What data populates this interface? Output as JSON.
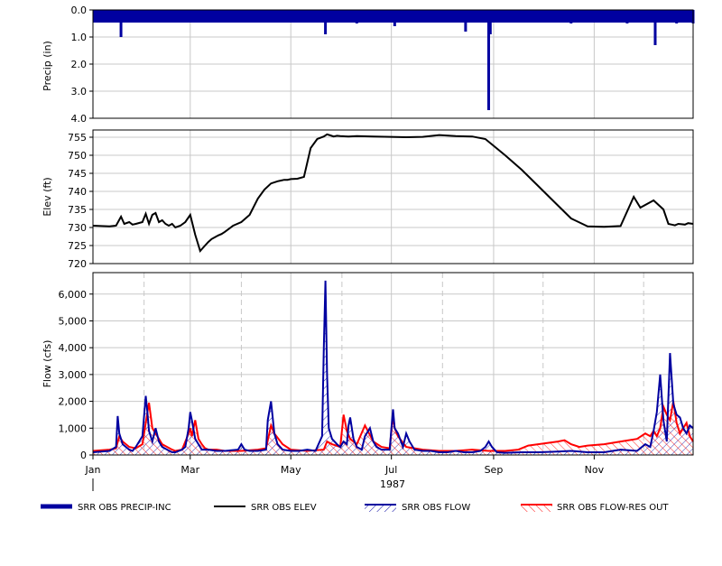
{
  "chart_data": [
    {
      "type": "bar",
      "panel": "precip",
      "ylabel": "Precip (in)",
      "ylim": [
        4.0,
        0.0
      ],
      "yticks": [
        "0.0",
        "1.0",
        "2.0",
        "3.0",
        "4.0"
      ],
      "ytick_values": [
        0,
        1,
        2,
        3,
        4
      ],
      "grid": true,
      "series": [
        {
          "name": "SRR OBS PRECIP-INC",
          "color": "#0000a0",
          "day": [
            3,
            6,
            10,
            14,
            17,
            20,
            24,
            29,
            33,
            38,
            44,
            51,
            56,
            59,
            63,
            70,
            76,
            80,
            85,
            90,
            96,
            102,
            105,
            110,
            114,
            120,
            126,
            130,
            136,
            141,
            146,
            150,
            153,
            160,
            162,
            167,
            172,
            175,
            179,
            183,
            186,
            189,
            196,
            201,
            206,
            210,
            214,
            218,
            226,
            233,
            239,
            240,
            241,
            246,
            253,
            259,
            266,
            270,
            278,
            284,
            290,
            296,
            302,
            306,
            309,
            313,
            316,
            319,
            324,
            327,
            330,
            334,
            337,
            341,
            346,
            350,
            354,
            357,
            361,
            364
          ],
          "values": [
            0.1,
            0.2,
            0.1,
            0.3,
            1.0,
            0.2,
            0.1,
            0.3,
            0.2,
            0.3,
            0.1,
            0.05,
            0.1,
            0.3,
            0.2,
            0.1,
            0.2,
            0.1,
            0.2,
            0.1,
            0.2,
            0.1,
            0.1,
            0.2,
            0.1,
            0.2,
            0.1,
            0.3,
            0.2,
            0.9,
            0.1,
            0.3,
            0.2,
            0.5,
            0.2,
            0.3,
            0.2,
            0.1,
            0.3,
            0.6,
            0.2,
            0.4,
            0.2,
            0.1,
            0.3,
            0.2,
            0.3,
            0.2,
            0.8,
            0.2,
            0.1,
            3.7,
            0.9,
            0.3,
            0.2,
            0.1,
            0.3,
            0.2,
            0.1,
            0.3,
            0.5,
            0.2,
            0.2,
            0.4,
            0.1,
            0.3,
            0.2,
            0.3,
            0.5,
            0.2,
            0.1,
            0.3,
            0.2,
            1.3,
            0.4,
            0.2,
            0.5,
            0.3,
            0.2,
            0.5
          ]
        }
      ]
    },
    {
      "type": "line",
      "panel": "elev",
      "ylabel": "Elev (ft)",
      "ylim": [
        720,
        757
      ],
      "yticks": [
        "720",
        "725",
        "730",
        "735",
        "740",
        "745",
        "750",
        "755"
      ],
      "ytick_values": [
        720,
        725,
        730,
        735,
        740,
        745,
        750,
        755
      ],
      "grid": true,
      "series": [
        {
          "name": "SRR OBS ELEV",
          "color": "#000000",
          "x_day": [
            0,
            10,
            14,
            17,
            19,
            22,
            24,
            26,
            30,
            32,
            34,
            36,
            38,
            40,
            42,
            44,
            46,
            48,
            50,
            53,
            56,
            59,
            62,
            65,
            68,
            70,
            72,
            74,
            76,
            78,
            80,
            85,
            90,
            95,
            100,
            104,
            108,
            112,
            114,
            116,
            118,
            120,
            124,
            128,
            132,
            136,
            140,
            142,
            144,
            146,
            148,
            150,
            155,
            160,
            170,
            180,
            190,
            200,
            210,
            220,
            230,
            238,
            242,
            250,
            260,
            270,
            280,
            290,
            300,
            310,
            320,
            328,
            332,
            340,
            346,
            349,
            351,
            353,
            355,
            357,
            359,
            361,
            364
          ],
          "y": [
            730.5,
            730.3,
            730.5,
            733,
            731,
            731.5,
            730.8,
            731,
            731.5,
            733.8,
            731,
            733.5,
            734,
            731.5,
            732,
            731,
            730.5,
            731,
            730,
            730.5,
            731.5,
            733.5,
            728,
            723.5,
            725,
            726,
            726.8,
            727.3,
            727.8,
            728.2,
            728.8,
            730.5,
            731.5,
            733.5,
            738,
            740.5,
            742.2,
            742.8,
            743,
            743.2,
            743.2,
            743.4,
            743.5,
            744,
            752,
            754.5,
            755.2,
            755.8,
            755.5,
            755.2,
            755.4,
            755.3,
            755.2,
            755.3,
            755.2,
            755.1,
            755,
            755.1,
            755.6,
            755.3,
            755.2,
            754.5,
            753,
            750,
            746,
            741.5,
            737,
            732.5,
            730.3,
            730.2,
            730.4,
            738.5,
            735.5,
            737.5,
            735,
            731,
            730.8,
            730.6,
            731,
            730.9,
            730.8,
            731.2,
            731
          ]
        }
      ]
    },
    {
      "type": "area",
      "panel": "flow",
      "ylabel": "Flow (cfs)",
      "ylim": [
        0,
        6800
      ],
      "yticks": [
        "0",
        "1,000",
        "2,000",
        "3,000",
        "4,000",
        "5,000",
        "6,000"
      ],
      "ytick_values": [
        0,
        1000,
        2000,
        3000,
        4000,
        5000,
        6000
      ],
      "xlabel": "1987",
      "x_ticks": [
        "Jan",
        "Mar",
        "May",
        "Jul",
        "Sep",
        "Nov"
      ],
      "x_tick_days": [
        0,
        59,
        120,
        181,
        243,
        304
      ],
      "grid": true,
      "series": [
        {
          "name": "SRR OBS FLOW",
          "color": "#0000a0",
          "x_day": [
            0,
            10,
            14,
            15,
            16,
            18,
            20,
            22,
            24,
            26,
            30,
            32,
            33,
            34,
            36,
            38,
            40,
            42,
            45,
            48,
            50,
            54,
            56,
            58,
            59,
            60,
            62,
            64,
            66,
            70,
            75,
            80,
            88,
            90,
            92,
            95,
            100,
            105,
            106,
            108,
            110,
            112,
            115,
            120,
            125,
            130,
            135,
            139,
            140,
            141,
            142,
            143,
            145,
            148,
            150,
            152,
            154,
            155,
            156,
            158,
            160,
            163,
            165,
            168,
            170,
            172,
            175,
            180,
            181,
            182,
            183,
            185,
            188,
            190,
            192,
            195,
            200,
            205,
            210,
            215,
            220,
            225,
            230,
            235,
            238,
            240,
            242,
            245,
            250,
            260,
            270,
            280,
            290,
            300,
            310,
            320,
            330,
            335,
            338,
            340,
            342,
            344,
            346,
            348,
            350,
            352,
            354,
            356,
            358,
            360,
            362,
            364
          ],
          "y": [
            100,
            150,
            300,
            1450,
            800,
            400,
            300,
            200,
            150,
            300,
            700,
            2200,
            1600,
            900,
            500,
            1000,
            500,
            300,
            200,
            100,
            100,
            200,
            300,
            1000,
            1600,
            1300,
            600,
            400,
            200,
            200,
            150,
            150,
            200,
            400,
            200,
            150,
            150,
            200,
            1300,
            2000,
            800,
            400,
            200,
            150,
            150,
            200,
            150,
            700,
            4000,
            6500,
            3000,
            1000,
            600,
            400,
            300,
            500,
            400,
            1100,
            1400,
            600,
            300,
            200,
            700,
            1000,
            500,
            300,
            200,
            200,
            1000,
            1700,
            1000,
            800,
            300,
            800,
            500,
            200,
            150,
            150,
            100,
            100,
            150,
            100,
            100,
            150,
            300,
            500,
            300,
            100,
            80,
            100,
            100,
            120,
            150,
            100,
            100,
            200,
            150,
            400,
            300,
            900,
            1600,
            3000,
            1300,
            500,
            3800,
            1900,
            1500,
            1400,
            1000,
            800,
            1100,
            1000,
            800
          ]
        },
        {
          "name": "SRR OBS FLOW-RES OUT",
          "color": "#ff0000",
          "x_day": [
            0,
            10,
            14,
            16,
            18,
            22,
            26,
            30,
            32,
            34,
            36,
            38,
            40,
            42,
            45,
            48,
            50,
            54,
            58,
            59,
            60,
            62,
            64,
            66,
            68,
            70,
            75,
            80,
            90,
            100,
            105,
            108,
            110,
            115,
            120,
            130,
            140,
            142,
            145,
            150,
            152,
            154,
            156,
            160,
            165,
            170,
            175,
            180,
            182,
            183,
            185,
            190,
            195,
            200,
            210,
            220,
            230,
            240,
            250,
            258,
            264,
            270,
            276,
            282,
            286,
            290,
            295,
            300,
            310,
            320,
            330,
            335,
            338,
            340,
            342,
            344,
            346,
            348,
            350,
            352,
            354,
            356,
            358,
            360,
            362,
            364
          ],
          "y": [
            150,
            200,
            250,
            700,
            500,
            300,
            250,
            400,
            1200,
            1950,
            1000,
            800,
            600,
            400,
            300,
            200,
            150,
            200,
            800,
            1000,
            700,
            1300,
            600,
            400,
            250,
            200,
            200,
            150,
            150,
            200,
            250,
            1100,
            800,
            400,
            200,
            150,
            200,
            500,
            400,
            300,
            1500,
            900,
            600,
            400,
            1100,
            500,
            300,
            250,
            1500,
            1000,
            700,
            300,
            250,
            200,
            150,
            150,
            200,
            150,
            150,
            200,
            350,
            400,
            450,
            500,
            550,
            400,
            300,
            350,
            400,
            500,
            600,
            800,
            700,
            900,
            700,
            1000,
            1800,
            1500,
            1300,
            2000,
            1200,
            800,
            1000,
            1200,
            700,
            500
          ]
        }
      ]
    }
  ]
}
